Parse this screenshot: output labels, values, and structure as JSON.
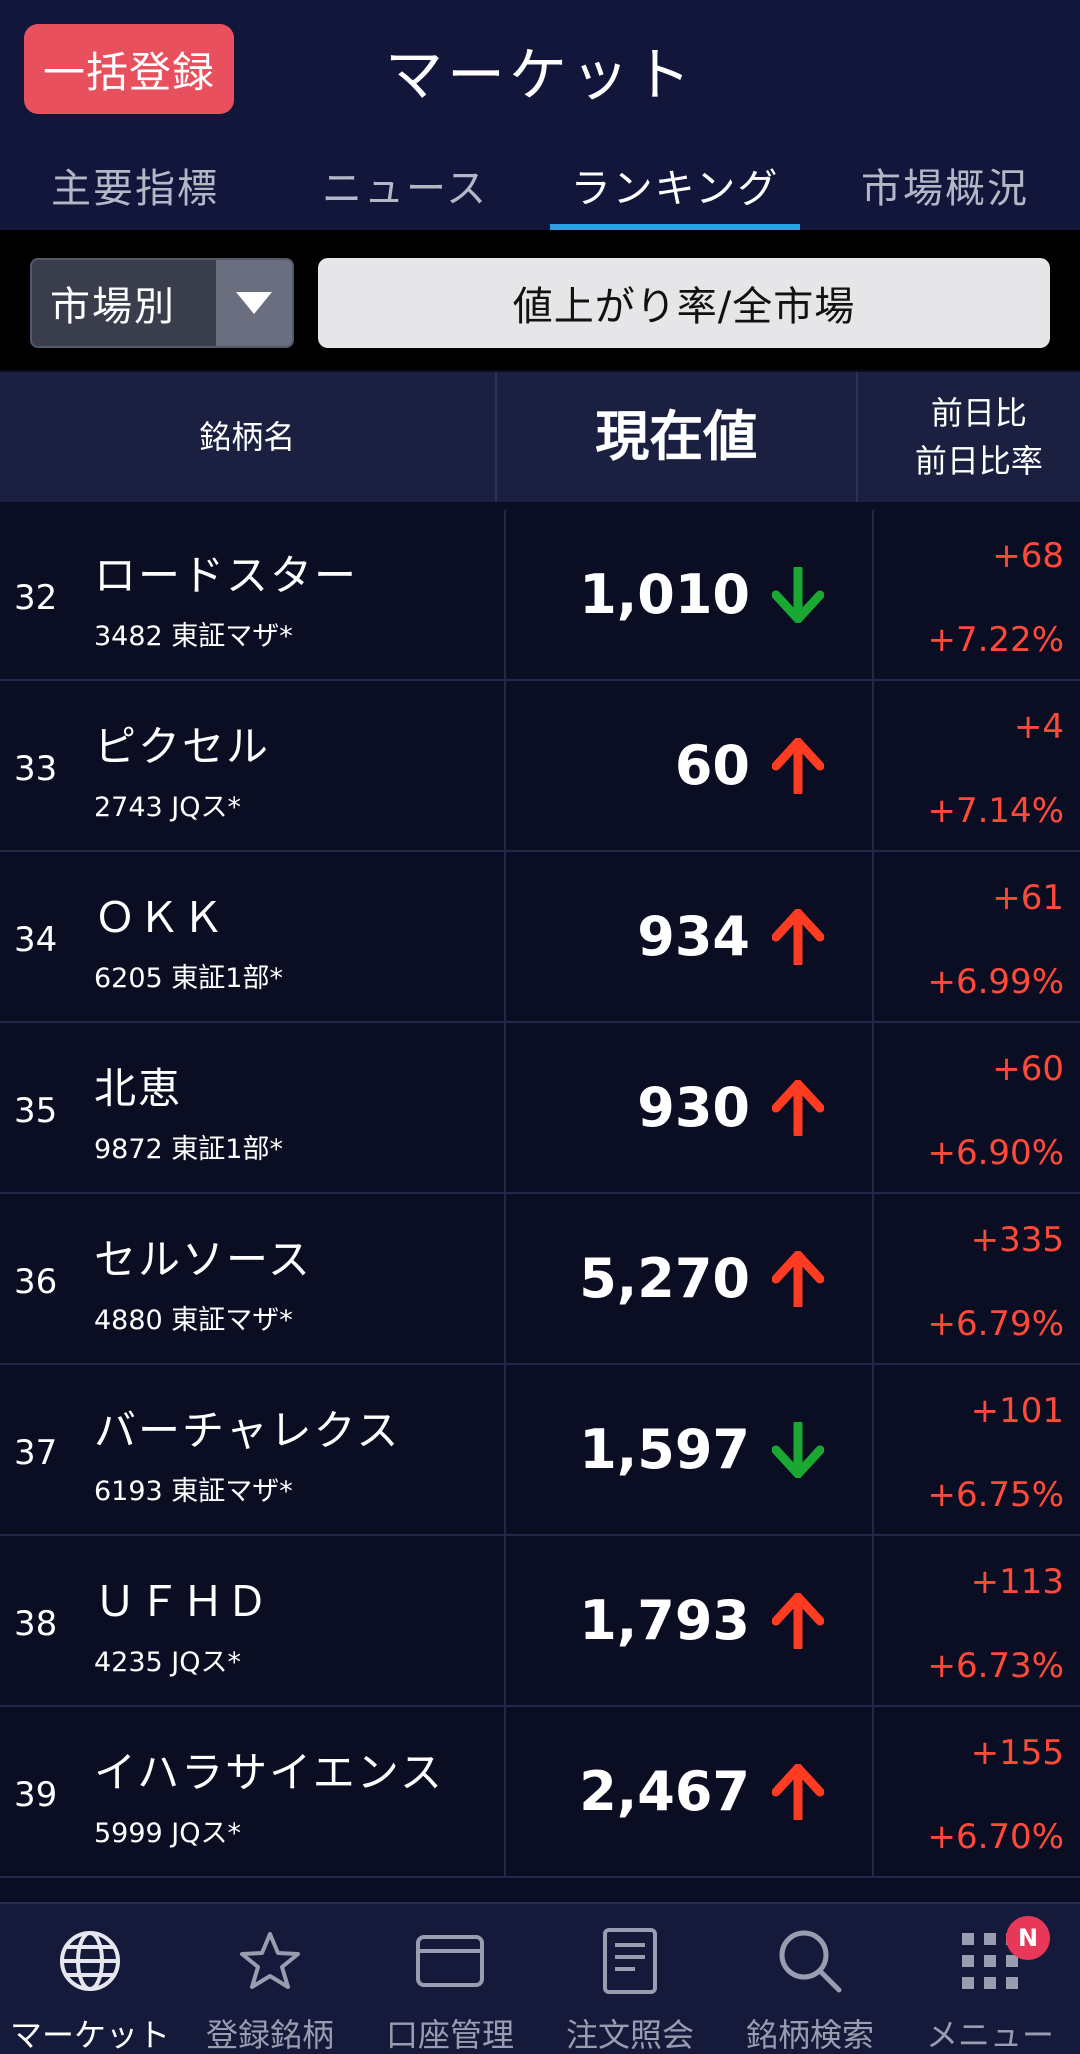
{
  "header": {
    "bulk_register_label": "一括登録",
    "title": "マーケット",
    "tabs": [
      {
        "label": "主要指標",
        "active": false
      },
      {
        "label": "ニュース",
        "active": false
      },
      {
        "label": "ランキング",
        "active": true
      },
      {
        "label": "市場概況",
        "active": false
      }
    ]
  },
  "filter": {
    "market_select_label": "市場別",
    "ranking_type_label": "値上がり率/全市場"
  },
  "table": {
    "columns": {
      "name": "銘柄名",
      "price": "現在値",
      "change_line1": "前日比",
      "change_line2": "前日比率"
    },
    "rows": [
      {
        "rank": "32",
        "name": "ロードスター",
        "code": "3482 東証マザ*",
        "price": "1,010",
        "trend": "down",
        "change": "+68",
        "change_pct": "+7.22%"
      },
      {
        "rank": "33",
        "name": "ピクセル",
        "code": "2743 JQス*",
        "price": "60",
        "trend": "up",
        "change": "+4",
        "change_pct": "+7.14%"
      },
      {
        "rank": "34",
        "name": "ＯＫＫ",
        "code": "6205 東証1部*",
        "price": "934",
        "trend": "up",
        "change": "+61",
        "change_pct": "+6.99%"
      },
      {
        "rank": "35",
        "name": "北恵",
        "code": "9872 東証1部*",
        "price": "930",
        "trend": "up",
        "change": "+60",
        "change_pct": "+6.90%"
      },
      {
        "rank": "36",
        "name": "セルソース",
        "code": "4880 東証マザ*",
        "price": "5,270",
        "trend": "up",
        "change": "+335",
        "change_pct": "+6.79%"
      },
      {
        "rank": "37",
        "name": "バーチャレクス",
        "code": "6193 東証マザ*",
        "price": "1,597",
        "trend": "down",
        "change": "+101",
        "change_pct": "+6.75%"
      },
      {
        "rank": "38",
        "name": "ＵＦＨＤ",
        "code": "4235 JQス*",
        "price": "1,793",
        "trend": "up",
        "change": "+113",
        "change_pct": "+6.73%"
      },
      {
        "rank": "39",
        "name": "イハラサイエンス",
        "code": "5999 JQス*",
        "price": "2,467",
        "trend": "up",
        "change": "+155",
        "change_pct": "+6.70%"
      }
    ]
  },
  "colors": {
    "up_arrow": "#ff3b22",
    "down_arrow": "#1aa832",
    "change_text": "#ff4a3a",
    "active_tab_underline": "#2f9ee0",
    "bulk_button": "#e8505e"
  },
  "bottom_nav": {
    "items": [
      {
        "label": "マーケット",
        "icon": "globe-icon",
        "active": true
      },
      {
        "label": "登録銘柄",
        "icon": "star-icon",
        "active": false
      },
      {
        "label": "口座管理",
        "icon": "card-icon",
        "active": false
      },
      {
        "label": "注文照会",
        "icon": "document-icon",
        "active": false
      },
      {
        "label": "銘柄検索",
        "icon": "search-icon",
        "active": false
      },
      {
        "label": "メニュー",
        "icon": "grid-menu-icon",
        "active": false,
        "badge": "N"
      }
    ]
  }
}
